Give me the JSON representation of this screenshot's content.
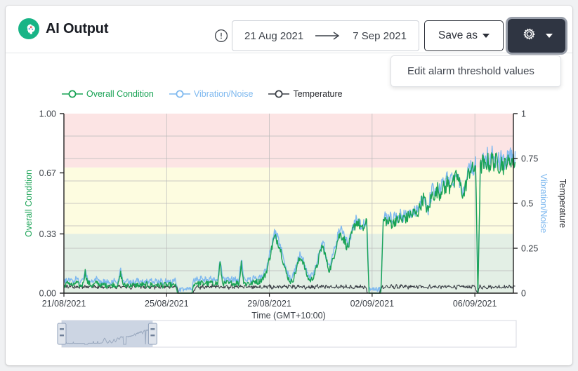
{
  "header": {
    "app_title": "AI Output",
    "logo_icon": "ai-brain-icon",
    "logo_color": "#18b486",
    "info_icon": "info-circle-icon",
    "date_from": "21 Aug 2021",
    "date_to": "7 Sep 2021",
    "date_arrow": "→",
    "save_as_label": "Save as",
    "gear_icon": "gear-icon",
    "gear_caret_icon": "chevron-down-icon"
  },
  "menu": {
    "items": [
      {
        "label": "Edit alarm threshold values"
      }
    ]
  },
  "chart_data": {
    "type": "line",
    "title": "",
    "xlabel": "Time (GMT+10:00)",
    "ylabel_left": "Overall Condition",
    "ylabel_right_1": "Vibration/Noise",
    "ylabel_right_2": "Temperature",
    "grid": true,
    "legend_position": "top-left",
    "left_axis": {
      "ticks": [
        "0.00",
        "0.33",
        "0.67",
        "1.00"
      ],
      "values": [
        0.0,
        0.33,
        0.67,
        1.0
      ],
      "ylim": [
        0,
        1
      ],
      "color": "#19a355"
    },
    "right_axis": {
      "ticks": [
        "0",
        "0.25",
        "0.5",
        "0.75",
        "1"
      ],
      "values": [
        0,
        0.25,
        0.5,
        0.75,
        1
      ],
      "ylim": [
        0,
        1
      ],
      "color": "#333333"
    },
    "x_ticks": [
      "21/08/2021",
      "25/08/2021",
      "29/08/2021",
      "02/09/2021",
      "06/09/2021"
    ],
    "x_range": [
      "21/08/2021",
      "07/09/2021"
    ],
    "alarm_bands": [
      {
        "name": "normal",
        "from": 0.0,
        "to": 0.33,
        "color": "#e3efe5"
      },
      {
        "name": "warning",
        "from": 0.33,
        "to": 0.7,
        "color": "#fdfce0"
      },
      {
        "name": "alarm",
        "from": 0.7,
        "to": 1.0,
        "color": "#fce4e4"
      }
    ],
    "series": [
      {
        "name": "Overall Condition",
        "color": "#19a355",
        "marker": "circle",
        "values": [
          0.04,
          0.05,
          0.06,
          0.05,
          0.04,
          0.06,
          0.05,
          0.04,
          0.05,
          0.12,
          0.06,
          0.05,
          0.04,
          0.05,
          0.06,
          0.05,
          0.04,
          0.05,
          0.04,
          0.05,
          0.04,
          0.05,
          0.04,
          0.05,
          0.11,
          0.05,
          0.04,
          0.05,
          0.04,
          0.05,
          0.04,
          0.05,
          0.04,
          0.05,
          0.04,
          0.05,
          0.04,
          0.05,
          0.04,
          0.05,
          0.04,
          0.05,
          0.04,
          0.05,
          0.04,
          0.05,
          0.04,
          0.05,
          0.0,
          0.0,
          0.0,
          0.0,
          0.0,
          0.0,
          0.0,
          0.05,
          0.06,
          0.05,
          0.06,
          0.05,
          0.06,
          0.05,
          0.06,
          0.05,
          0.06,
          0.05,
          0.17,
          0.06,
          0.05,
          0.06,
          0.05,
          0.06,
          0.05,
          0.06,
          0.05,
          0.17,
          0.06,
          0.05,
          0.06,
          0.05,
          0.06,
          0.07,
          0.06,
          0.07,
          0.08,
          0.1,
          0.14,
          0.2,
          0.26,
          0.31,
          0.3,
          0.27,
          0.22,
          0.16,
          0.11,
          0.08,
          0.06,
          0.08,
          0.12,
          0.17,
          0.2,
          0.18,
          0.13,
          0.09,
          0.07,
          0.08,
          0.11,
          0.15,
          0.21,
          0.26,
          0.24,
          0.18,
          0.13,
          0.15,
          0.2,
          0.26,
          0.31,
          0.33,
          0.31,
          0.28,
          0.25,
          0.29,
          0.34,
          0.38,
          0.4,
          0.38,
          0.35,
          0.37,
          0.39,
          0.0,
          0.0,
          0.0,
          0.0,
          0.0,
          0.0,
          0.4,
          0.41,
          0.39,
          0.4,
          0.38,
          0.41,
          0.4,
          0.42,
          0.4,
          0.43,
          0.41,
          0.44,
          0.43,
          0.45,
          0.44,
          0.46,
          0.5,
          0.53,
          0.49,
          0.45,
          0.52,
          0.56,
          0.54,
          0.58,
          0.55,
          0.6,
          0.57,
          0.62,
          0.59,
          0.64,
          0.61,
          0.66,
          0.62,
          0.58,
          0.54,
          0.61,
          0.66,
          0.7,
          0.68,
          0.72,
          0.0,
          0.69,
          0.73,
          0.7,
          0.74,
          0.71,
          0.75,
          0.72,
          0.74,
          0.71,
          0.73,
          0.7,
          0.74,
          0.72,
          0.75,
          0.73
        ]
      },
      {
        "name": "Vibration/Noise",
        "color": "#7fb9ef",
        "marker": "circle",
        "values": [
          0.06,
          0.07,
          0.08,
          0.07,
          0.06,
          0.08,
          0.07,
          0.06,
          0.07,
          0.14,
          0.08,
          0.07,
          0.06,
          0.07,
          0.08,
          0.07,
          0.06,
          0.07,
          0.06,
          0.07,
          0.06,
          0.07,
          0.06,
          0.07,
          0.13,
          0.07,
          0.06,
          0.07,
          0.06,
          0.07,
          0.06,
          0.07,
          0.06,
          0.07,
          0.06,
          0.07,
          0.06,
          0.07,
          0.06,
          0.07,
          0.06,
          0.07,
          0.06,
          0.07,
          0.06,
          0.07,
          0.06,
          0.07,
          0.02,
          0.02,
          0.02,
          0.02,
          0.02,
          0.02,
          0.02,
          0.07,
          0.08,
          0.07,
          0.08,
          0.07,
          0.08,
          0.07,
          0.08,
          0.07,
          0.08,
          0.07,
          0.19,
          0.08,
          0.07,
          0.08,
          0.07,
          0.08,
          0.07,
          0.08,
          0.07,
          0.19,
          0.08,
          0.07,
          0.08,
          0.07,
          0.08,
          0.09,
          0.08,
          0.09,
          0.1,
          0.12,
          0.16,
          0.22,
          0.28,
          0.33,
          0.32,
          0.29,
          0.24,
          0.18,
          0.13,
          0.1,
          0.08,
          0.1,
          0.14,
          0.19,
          0.22,
          0.2,
          0.15,
          0.11,
          0.09,
          0.1,
          0.13,
          0.17,
          0.23,
          0.28,
          0.26,
          0.2,
          0.15,
          0.17,
          0.22,
          0.28,
          0.33,
          0.35,
          0.33,
          0.3,
          0.27,
          0.31,
          0.36,
          0.4,
          0.42,
          0.4,
          0.37,
          0.39,
          0.41,
          0.02,
          0.02,
          0.02,
          0.02,
          0.02,
          0.02,
          0.42,
          0.43,
          0.41,
          0.42,
          0.4,
          0.43,
          0.42,
          0.44,
          0.42,
          0.45,
          0.43,
          0.46,
          0.45,
          0.47,
          0.46,
          0.48,
          0.52,
          0.55,
          0.51,
          0.47,
          0.54,
          0.58,
          0.56,
          0.6,
          0.57,
          0.62,
          0.59,
          0.64,
          0.61,
          0.66,
          0.63,
          0.68,
          0.64,
          0.6,
          0.56,
          0.63,
          0.68,
          0.72,
          0.7,
          0.74,
          0.02,
          0.71,
          0.75,
          0.72,
          0.76,
          0.73,
          0.77,
          0.74,
          0.76,
          0.73,
          0.75,
          0.72,
          0.76,
          0.74,
          0.77,
          0.75
        ]
      },
      {
        "name": "Temperature",
        "color": "#3a3f46",
        "marker": "circle",
        "values": [
          0.03,
          0.04,
          0.03,
          0.04,
          0.03,
          0.04,
          0.03,
          0.04,
          0.03,
          0.04,
          0.03,
          0.04,
          0.03,
          0.04,
          0.03,
          0.04,
          0.03,
          0.04,
          0.03,
          0.04,
          0.03,
          0.04,
          0.03,
          0.04,
          0.03,
          0.04,
          0.03,
          0.04,
          0.03,
          0.04,
          0.03,
          0.04,
          0.03,
          0.04,
          0.03,
          0.04,
          0.03,
          0.04,
          0.03,
          0.04,
          0.03,
          0.04,
          0.03,
          0.04,
          0.03,
          0.04,
          0.03,
          0.04,
          0.0,
          0.0,
          0.0,
          0.0,
          0.0,
          0.0,
          0.0,
          0.03,
          0.04,
          0.03,
          0.04,
          0.03,
          0.04,
          0.03,
          0.04,
          0.03,
          0.04,
          0.03,
          0.04,
          0.03,
          0.04,
          0.03,
          0.04,
          0.03,
          0.04,
          0.03,
          0.04,
          0.03,
          0.04,
          0.03,
          0.04,
          0.03,
          0.04,
          0.03,
          0.04,
          0.03,
          0.04,
          0.03,
          0.04,
          0.03,
          0.04,
          0.03,
          0.04,
          0.03,
          0.04,
          0.03,
          0.04,
          0.03,
          0.04,
          0.03,
          0.04,
          0.03,
          0.04,
          0.03,
          0.04,
          0.03,
          0.04,
          0.03,
          0.04,
          0.03,
          0.04,
          0.03,
          0.04,
          0.03,
          0.04,
          0.03,
          0.04,
          0.03,
          0.04,
          0.03,
          0.04,
          0.03,
          0.04,
          0.03,
          0.04,
          0.03,
          0.04,
          0.03,
          0.04,
          0.0,
          0.0,
          0.0,
          0.0,
          0.0,
          0.0,
          0.04,
          0.03,
          0.04,
          0.03,
          0.04,
          0.03,
          0.04,
          0.03,
          0.04,
          0.03,
          0.04,
          0.03,
          0.04,
          0.03,
          0.04,
          0.03,
          0.04,
          0.03,
          0.04,
          0.03,
          0.04,
          0.03,
          0.04,
          0.03,
          0.04,
          0.03,
          0.04,
          0.03,
          0.04,
          0.03,
          0.04,
          0.03,
          0.04,
          0.03,
          0.04,
          0.03,
          0.04,
          0.03,
          0.04,
          0.03,
          0.0,
          0.04,
          0.03,
          0.04,
          0.03,
          0.04,
          0.03,
          0.04,
          0.03,
          0.04,
          0.03,
          0.04,
          0.03,
          0.04,
          0.03,
          0.04
        ]
      }
    ]
  },
  "range_slider": {
    "selection_start_pct": 0,
    "selection_end_pct": 20,
    "handle_left": "range-handle-left",
    "handle_right": "range-handle-right"
  }
}
